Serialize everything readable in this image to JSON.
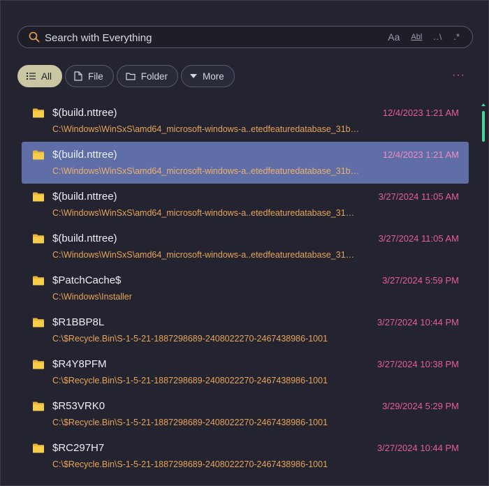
{
  "search": {
    "placeholder": "Search with Everything",
    "value": "",
    "options": {
      "match_case": "Aa",
      "whole_word": "Abl",
      "match_path": "..\\",
      "regex": ".*"
    }
  },
  "filters": [
    {
      "label": "All",
      "icon": "list-icon",
      "active": true
    },
    {
      "label": "File",
      "icon": "file-icon",
      "active": false
    },
    {
      "label": "Folder",
      "icon": "folder-outline-icon",
      "active": false
    },
    {
      "label": "More",
      "icon": "caret-down-icon",
      "active": false
    }
  ],
  "more_menu": "···",
  "results": [
    {
      "name": "$(build.nttree)",
      "path": "C:\\Windows\\WinSxS\\amd64_microsoft-windows-a..etedfeaturedatabase_31b…",
      "date": "12/4/2023 1:21 AM",
      "selected": false
    },
    {
      "name": "$(build.nttree)",
      "path": "C:\\Windows\\WinSxS\\amd64_microsoft-windows-a..etedfeaturedatabase_31b…",
      "date": "12/4/2023 1:21 AM",
      "selected": true
    },
    {
      "name": "$(build.nttree)",
      "path": "C:\\Windows\\WinSxS\\amd64_microsoft-windows-a..etedfeaturedatabase_31…",
      "date": "3/27/2024 11:05 AM",
      "selected": false
    },
    {
      "name": "$(build.nttree)",
      "path": "C:\\Windows\\WinSxS\\amd64_microsoft-windows-a..etedfeaturedatabase_31…",
      "date": "3/27/2024 11:05 AM",
      "selected": false
    },
    {
      "name": "$PatchCache$",
      "path": "C:\\Windows\\Installer",
      "date": "3/27/2024 5:59 PM",
      "selected": false
    },
    {
      "name": "$R1BBP8L",
      "path": "C:\\$Recycle.Bin\\S-1-5-21-1887298689-2408022270-2467438986-1001",
      "date": "3/27/2024 10:44 PM",
      "selected": false
    },
    {
      "name": "$R4Y8PFM",
      "path": "C:\\$Recycle.Bin\\S-1-5-21-1887298689-2408022270-2467438986-1001",
      "date": "3/27/2024 10:38 PM",
      "selected": false
    },
    {
      "name": "$R53VRK0",
      "path": "C:\\$Recycle.Bin\\S-1-5-21-1887298689-2408022270-2467438986-1001",
      "date": "3/29/2024 5:29 PM",
      "selected": false
    },
    {
      "name": "$RC297H7",
      "path": "C:\\$Recycle.Bin\\S-1-5-21-1887298689-2408022270-2467438986-1001",
      "date": "3/27/2024 10:44 PM",
      "selected": false
    }
  ],
  "colors": {
    "background": "#23242f",
    "selection": "#5f6ea6",
    "active_chip": "#c9c6a4",
    "path_text": "#e8a35b",
    "date_text": "#e65d9d",
    "folder_icon": "#f5c842",
    "scroll_thumb": "#48d597",
    "accent": "#e8a35b"
  }
}
